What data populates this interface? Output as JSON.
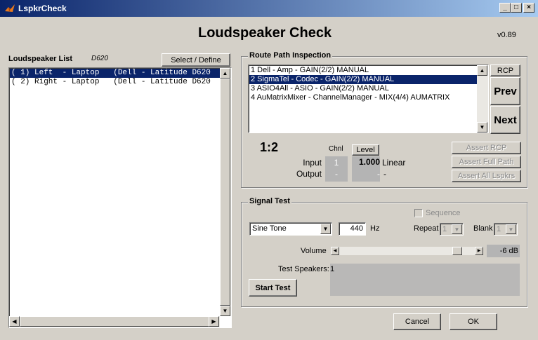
{
  "window": {
    "title": "LspkrCheck",
    "minimize_label": "_",
    "maximize_label": "□",
    "close_label": "×"
  },
  "header": {
    "title": "Loudspeaker Check",
    "version": "v0.89"
  },
  "speaker_list": {
    "label": "Loudspeaker List",
    "device": "D620",
    "select_button": "Select / Define",
    "items": [
      "( 1) Left  - Laptop   (Dell - Latitude D620",
      "( 2) Right - Laptop   (Dell - Latitude D620"
    ],
    "selected_index": 0
  },
  "route": {
    "label": "Route Path Inspection",
    "items": [
      "1 Dell - Amp - GAIN(2/2) MANUAL",
      "2 SigmaTel - Codec - GAIN(2/2) MANUAL",
      "3 ASIO4All - ASIO - GAIN(2/2) MANUAL",
      "4 AuMatrixMixer - ChannelManager - MIX(4/4) AUMATRIX"
    ],
    "selected_index": 1,
    "rcp_label": "RCP",
    "prev_label": "Prev",
    "next_label": "Next",
    "ratio": "1:2",
    "chnl_header": "Chnl",
    "level_button": "Level",
    "input_label": "Input",
    "output_label": "Output",
    "input_chnl": "1",
    "output_chnl": "-",
    "input_level": "1.000",
    "output_level": "-",
    "input_unit": "Linear",
    "output_unit": "-",
    "assert_rcp": "Assert RCP",
    "assert_full_path": "Assert Full Path",
    "assert_all": "Assert All Lspkrs"
  },
  "signal": {
    "label": "Signal Test",
    "sequence_label": "Sequence",
    "tone_selected": "Sine Tone",
    "frequency": "440",
    "freq_unit": "Hz",
    "repeat_label": "Repeat",
    "repeat_value": "1",
    "blank_label": "Blank",
    "blank_value": "1",
    "volume_label": "Volume",
    "volume_value": "-6 dB",
    "volume_fraction": 0.9,
    "test_speakers_label": "Test Speakers:",
    "test_speakers_value": "1",
    "start_button": "Start Test"
  },
  "footer": {
    "cancel": "Cancel",
    "ok": "OK"
  }
}
